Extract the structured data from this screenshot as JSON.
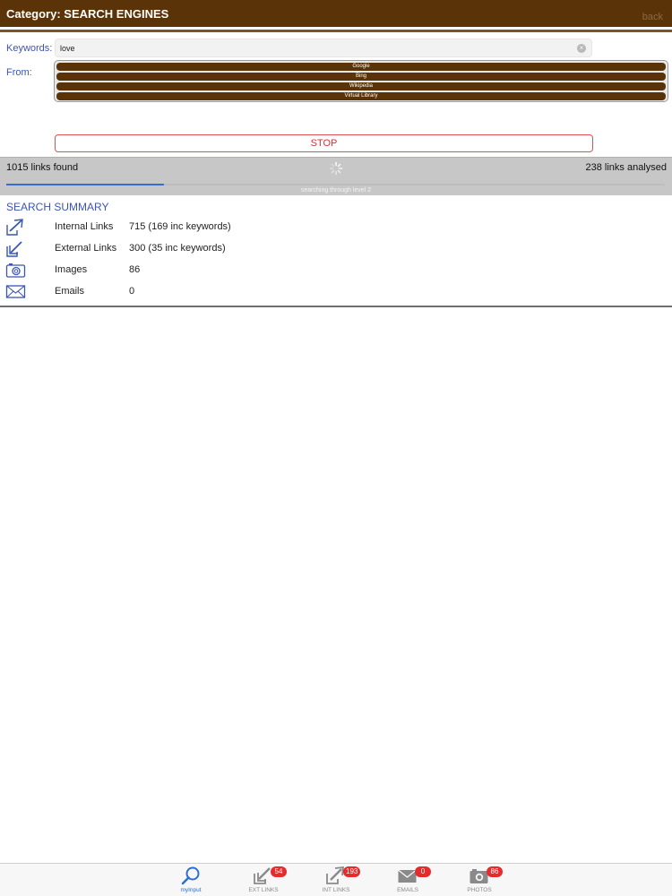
{
  "header": {
    "title": "Category: SEARCH ENGINES",
    "back_label": "back"
  },
  "form": {
    "keywords_label": "Keywords:",
    "keywords_value": "love",
    "from_label": "From:",
    "sources": [
      "Google",
      "Bing",
      "Wikipedia",
      "Virtual Library"
    ],
    "stop_label": "STOP"
  },
  "status": {
    "links_found": "1015 links found",
    "links_analysed": "238 links analysed",
    "message": "searching through level 2",
    "progress": 0.24
  },
  "summary": {
    "title": "SEARCH SUMMARY",
    "rows": [
      {
        "icon": "internal-link-icon",
        "name": "Internal Links",
        "value": "715 (169 inc keywords)"
      },
      {
        "icon": "external-link-icon",
        "name": "External Links",
        "value": "300 (35 inc keywords)"
      },
      {
        "icon": "camera-icon",
        "name": "Images",
        "value": "86"
      },
      {
        "icon": "envelope-icon",
        "name": "Emails",
        "value": "0"
      }
    ]
  },
  "tabs": [
    {
      "icon": "search-icon",
      "label": "myInput",
      "badge": "",
      "active": true
    },
    {
      "icon": "external-link-icon",
      "label": "EXT LINKS",
      "badge": "54",
      "active": false
    },
    {
      "icon": "internal-link-icon",
      "label": "INT LINKS",
      "badge": "193",
      "active": false
    },
    {
      "icon": "envelope-icon",
      "label": "EMAILS",
      "badge": "0",
      "active": false
    },
    {
      "icon": "camera-icon",
      "label": "PHOTOS",
      "badge": "86",
      "active": false
    }
  ],
  "colors": {
    "brand_brown": "#5a3408",
    "accent_blue": "#3a55b4",
    "stop_red": "#d83030",
    "badge_red": "#e52b2b"
  }
}
